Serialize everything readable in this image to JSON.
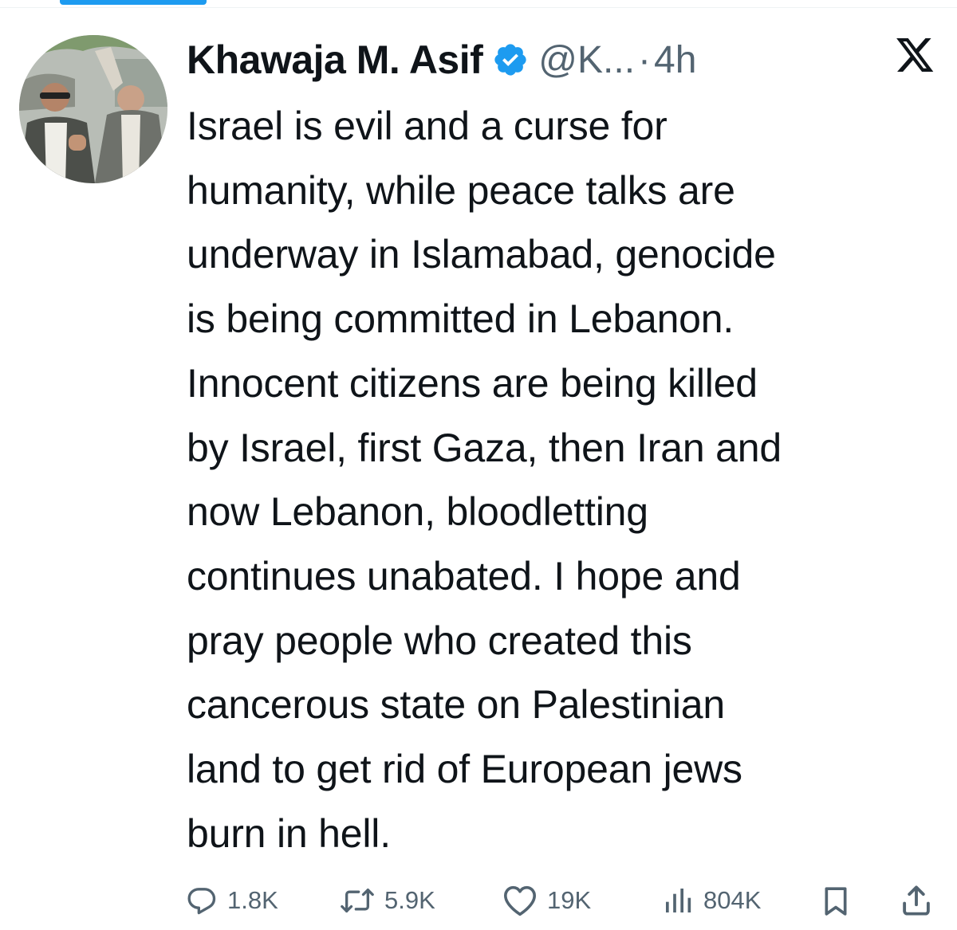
{
  "tweet": {
    "author": {
      "display_name": "Khawaja M. Asif",
      "verified": true,
      "handle": "@K...",
      "separator": "·",
      "timestamp": "4h"
    },
    "platform_icon": "x-logo-icon",
    "text": "Israel is evil and a curse for\nhumanity, while peace talks are\nunderway in Islamabad, genocide\nis being committed in Lebanon.\nInnocent citizens are being killed\nby Israel, first Gaza, then Iran and\nnow Lebanon, bloodletting\ncontinues unabated. I hope and\npray people who created this\ncancerous state on Palestinian\nland to get rid of European jews\nburn in hell.",
    "actions": {
      "replies": "1.8K",
      "reposts": "5.9K",
      "likes": "19K",
      "views": "804K"
    }
  },
  "colors": {
    "accent": "#1d9bf0",
    "text": "#0f1419",
    "muted": "#536471"
  }
}
